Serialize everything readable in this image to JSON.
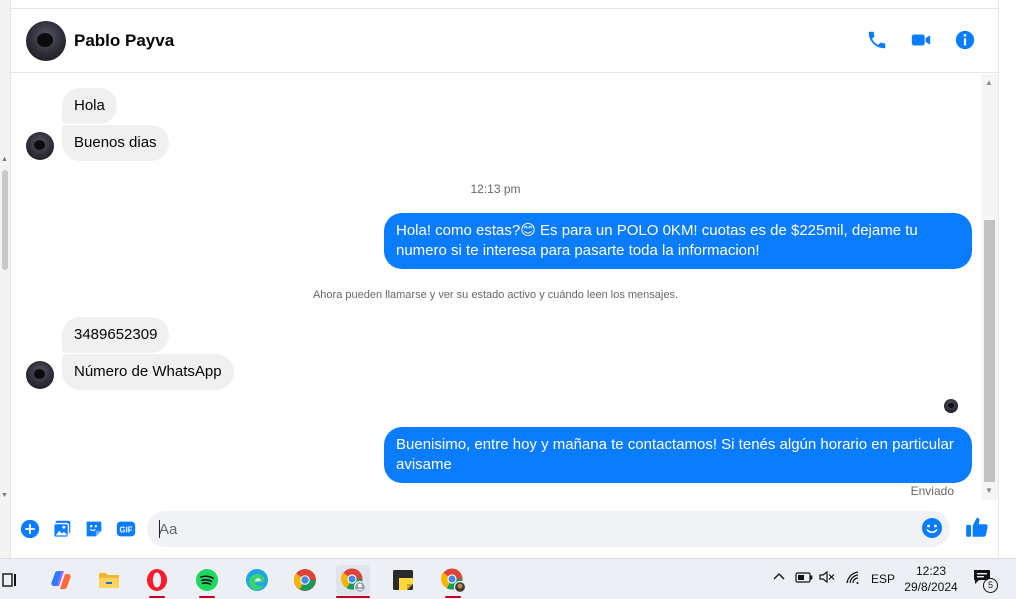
{
  "contact": {
    "name": "Pablo Payva"
  },
  "header": {
    "call_icon": "phone-icon",
    "video_icon": "video-camera-icon",
    "info_icon": "info-icon",
    "accent_color": "#0a7cff"
  },
  "messages": {
    "in_group_1": [
      "Hola",
      "Buenos dias"
    ],
    "timestamp_1": "12:13 pm",
    "out_1": "Hola! como estas?😊 Es para un POLO 0KM! cuotas es de $225mil, dejame tu numero si te interesa para pasarte toda la informacion!",
    "system_note": "Ahora pueden llamarse y ver su estado activo y cuándo leen los mensajes.",
    "in_group_2": [
      "3489652309",
      "Número de WhatsApp"
    ],
    "out_2": "Buenisimo, entre hoy y mañana te contactamos! Si tenés algún horario en particular avisame",
    "status": "Enviado"
  },
  "composer": {
    "placeholder": "Aa",
    "icons": [
      "plus-circle-icon",
      "image-icon",
      "sticker-icon",
      "gif-icon",
      "emoji-icon",
      "thumbs-up-icon"
    ],
    "gif_label": "GIF"
  },
  "taskbar": {
    "apps": [
      "task-view-icon",
      "copilot-icon",
      "file-explorer-icon",
      "opera-icon",
      "spotify-icon",
      "edge-icon",
      "chrome-icon",
      "chrome-profile-icon",
      "sticky-notes-icon",
      "chrome-profile-2-icon"
    ],
    "language": "ESP",
    "time": "12:23",
    "date": "29/8/2024",
    "notification_count": "5"
  }
}
